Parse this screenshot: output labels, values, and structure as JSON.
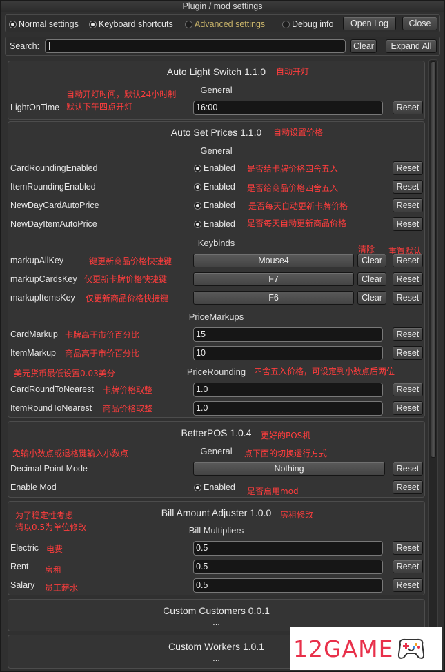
{
  "window": {
    "title": "Plugin / mod settings"
  },
  "tabs": {
    "normal": "Normal settings",
    "keyboard": "Keyboard shortcuts",
    "advanced": "Advanced settings",
    "debug": "Debug info",
    "open_log": "Open Log",
    "close": "Close"
  },
  "search": {
    "label": "Search:",
    "value": "",
    "clear": "Clear",
    "expand_all": "Expand All"
  },
  "common": {
    "reset": "Reset",
    "clear": "Clear",
    "enabled": "Enabled",
    "ellipsis": "..."
  },
  "plugins": {
    "auto_light": {
      "title": "Auto Light Switch 1.1.0",
      "note": "自动开灯",
      "category": "General",
      "light_on_time": {
        "label": "LightOnTime",
        "value": "16:00",
        "note1": "自动开灯时间，默认24小时制",
        "note2": "默认下午四点开灯"
      }
    },
    "auto_prices": {
      "title": "Auto Set Prices 1.1.0",
      "note": "自动设置价格",
      "cat_general": "General",
      "card_rounding": {
        "label": "CardRoundingEnabled",
        "note": "是否给卡牌价格四舍五入"
      },
      "item_rounding": {
        "label": "ItemRoundingEnabled",
        "note": "是否给商品价格四舍五入"
      },
      "new_day_card": {
        "label": "NewDayCardAutoPrice",
        "note": "是否每天自动更新卡牌价格"
      },
      "new_day_item": {
        "label": "NewDayItemAutoPrice",
        "note": "是否每天自动更新商品价格"
      },
      "cat_keybinds": "Keybinds",
      "clear_note": "清除",
      "reset_note": "重置默认",
      "markup_all": {
        "label": "markupAllKey",
        "value": "Mouse4",
        "note": "一键更新商品价格快捷键"
      },
      "markup_cards": {
        "label": "markupCardsKey",
        "value": "F7",
        "note": "仅更新卡牌价格快捷键"
      },
      "markup_items": {
        "label": "markupItemsKey",
        "value": "F6",
        "note": "仅更新商品价格快捷键"
      },
      "cat_markups": "PriceMarkups",
      "card_markup": {
        "label": "CardMarkup",
        "value": "15",
        "note": "卡牌高于市价百分比"
      },
      "item_markup": {
        "label": "ItemMarkup",
        "value": "10",
        "note": "商品高于市价百分比"
      },
      "cat_rounding": "PriceRounding",
      "rounding_note": "四舍五入价格，可设定到小数点后两位",
      "usd_note": "美元货币最低设置0.03美分",
      "card_round": {
        "label": "CardRoundToNearest",
        "value": "1.0",
        "note": "卡牌价格取整"
      },
      "item_round": {
        "label": "ItemRoundToNearest",
        "value": "1.0",
        "note": "商品价格取整"
      }
    },
    "better_pos": {
      "title": "BetterPOS 1.0.4",
      "note": "更好的POS机",
      "category": "General",
      "left_note": "免输小数点或退格键输入小数点",
      "cat_note": "点下面的切换运行方式",
      "decimal_mode": {
        "label": "Decimal Point Mode",
        "value": "Nothing"
      },
      "enable_mod": {
        "label": "Enable Mod",
        "note": "是否启用mod"
      }
    },
    "bill_adjuster": {
      "title": "Bill Amount Adjuster 1.0.0",
      "note": "房租修改",
      "left_note1": "为了稳定性考虑",
      "left_note2": "请以0.5为单位修改",
      "category": "Bill Multipliers",
      "electric": {
        "label": "Electric",
        "value": "0.5",
        "note": "电费"
      },
      "rent": {
        "label": "Rent",
        "value": "0.5",
        "note": "房租"
      },
      "salary": {
        "label": "Salary",
        "value": "0.5",
        "note": "员工薪水"
      }
    },
    "custom_customers": {
      "title": "Custom Customers 0.0.1"
    },
    "custom_workers": {
      "title": "Custom Workers 1.0.1"
    }
  },
  "watermark": {
    "text": "12GAME",
    "icon": "gamepad-icon"
  },
  "colors": {
    "annotation": "#ff3d3d",
    "active_tab": "#c9b46a",
    "watermark": "#e8304a"
  }
}
